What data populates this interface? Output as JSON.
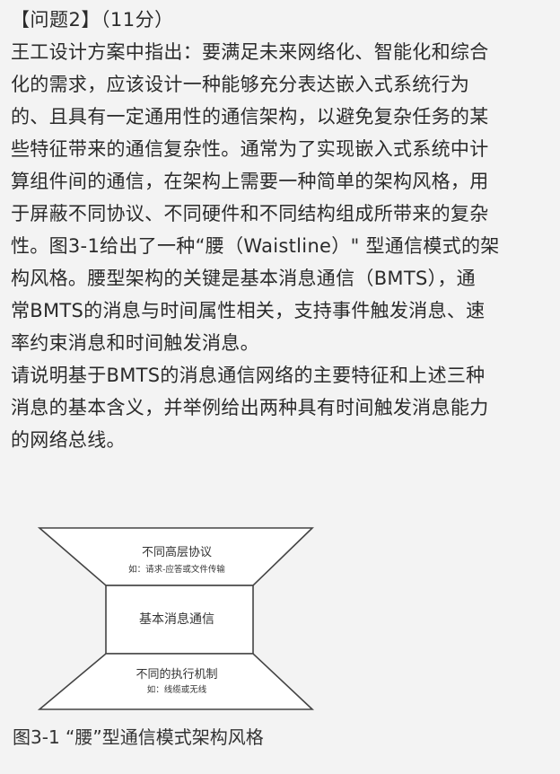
{
  "question": {
    "title": "【问题2】（11分）",
    "lines": [
      "王工设计方案中指出：要满足未来网络化、智能化和综合",
      "化的需求，应该设计一种能够充分表达嵌入式系统行为",
      "的、且具有一定通用性的通信架构，以避免复杂任务的某",
      "些特征带来的通信复杂性。通常为了实现嵌入式系统中计",
      "算组件间的通信，在架构上需要一种简单的架构风格，用",
      "于屏蔽不同协议、不同硬件和不同结构组成所带来的复杂",
      "性。图3-1给出了一种“腰（Waistline）\" 型通信模式的架",
      "构风格。腰型架构的关键是基本消息通信（BMTS），通",
      "常BMTS的消息与时间属性相关，支持事件触发消息、速",
      "率约束消息和时间触发消息。",
      "请说明基于BMTS的消息通信网络的主要特征和上述三种",
      "消息的基本含义，并举例给出两种具有时间触发消息能力",
      "的网络总线。"
    ]
  },
  "figure": {
    "top": {
      "label": "不同高层协议",
      "sub": "如：请求-应答或文件传输"
    },
    "middle": {
      "label": "基本消息通信"
    },
    "bottom": {
      "label": "不同的执行机制",
      "sub": "如：线缆或无线"
    },
    "caption": "图3-1 “腰”型通信模式架构风格"
  }
}
